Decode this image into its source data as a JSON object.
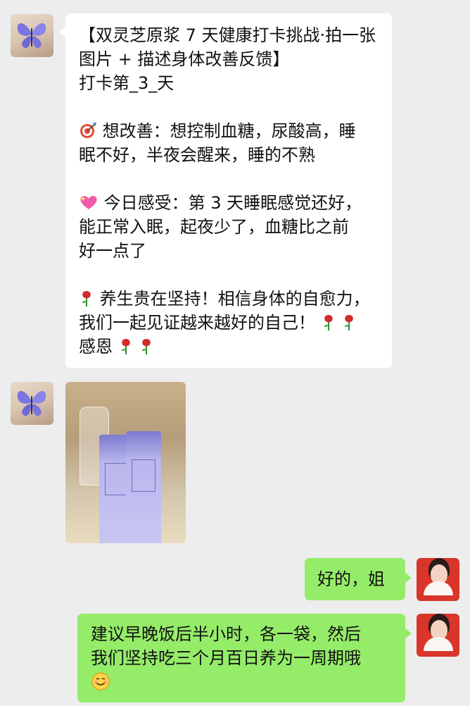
{
  "chat": {
    "messages": [
      {
        "sender": "contact",
        "avatar": "butterfly-avatar",
        "type": "text",
        "lines": [
          "【双灵芝原浆 7 天健康打卡挑战·拍一张",
          "图片 + 描述身体改善反馈】",
          "打卡第_3_天",
          "",
          "想改善：想控制血糖，尿酸高，睡",
          "眠不好，半夜会醒来，睡的不熟",
          "",
          "今日感受：第 3 天睡眠感觉还好，",
          "能正常入眠，起夜少了，血糖比之前",
          "好一点了",
          "",
          "养生贵在坚持！相信身体的自愈力，",
          "我们一起见证越来越好的自己！",
          "感恩"
        ],
        "icons": [
          "target-icon",
          "heart-icon",
          "rose-icon"
        ]
      },
      {
        "sender": "contact",
        "avatar": "butterfly-avatar",
        "type": "image",
        "image_desc": "photo-of-sachets"
      },
      {
        "sender": "me",
        "avatar": "portrait-avatar",
        "type": "text",
        "text": "好的，姐"
      },
      {
        "sender": "me",
        "avatar": "portrait-avatar",
        "type": "text",
        "lines": [
          "建议早晚饭后半小时，各一袋，然后",
          "我们坚持吃三个月百日养为一周期哦"
        ],
        "icons": [
          "smile-icon"
        ]
      }
    ]
  },
  "colors": {
    "background": "#ededed",
    "incoming_bubble": "#ffffff",
    "outgoing_bubble": "#95ec69",
    "text": "#111111"
  }
}
